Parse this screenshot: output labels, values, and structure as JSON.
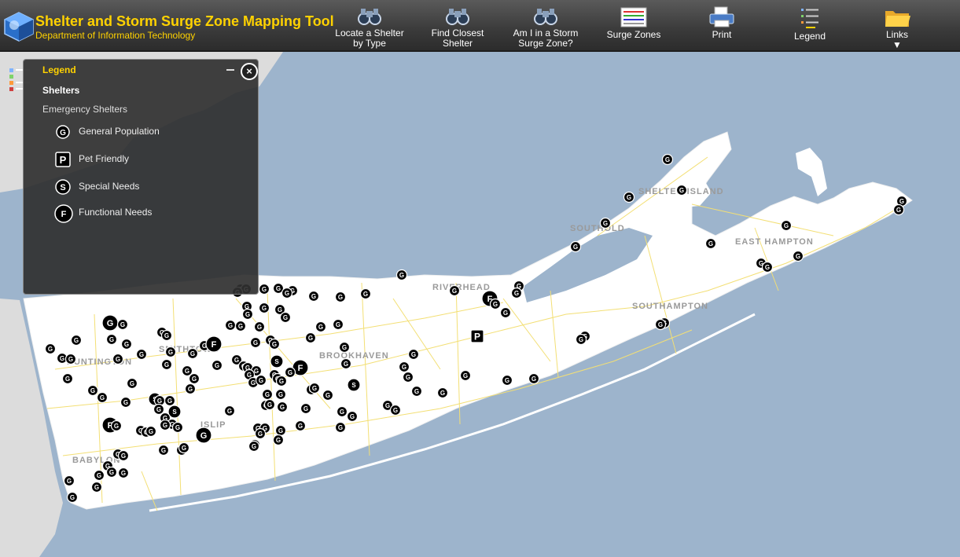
{
  "header": {
    "title": "Shelter and Storm Surge Zone Mapping Tool",
    "subtitle": "Department of Information Technology"
  },
  "toolbar": [
    {
      "label": "Locate a Shelter\nby Type",
      "icon": "binoculars-icon"
    },
    {
      "label": "Find Closest\nShelter",
      "icon": "binoculars-icon"
    },
    {
      "label": "Am I in a Storm\nSurge Zone?",
      "icon": "binoculars-icon"
    },
    {
      "label": "Surge Zones",
      "icon": "map-table-icon"
    },
    {
      "label": "Print",
      "icon": "printer-icon"
    },
    {
      "label": "Legend",
      "icon": "legend-list-icon"
    },
    {
      "label": "Links\n▼",
      "icon": "folder-icon"
    }
  ],
  "legend": {
    "title": "Legend",
    "layer": "Shelters",
    "group": "Emergency Shelters",
    "items": [
      {
        "letter": "G",
        "label": "General Population"
      },
      {
        "letter": "P",
        "label": "Pet Friendly"
      },
      {
        "letter": "S",
        "label": "Special Needs"
      },
      {
        "letter": "F",
        "label": "Functional Needs"
      }
    ]
  },
  "map": {
    "colors": {
      "water": "#9db4cc",
      "land": "#ffffff",
      "mainland": "#dcdcdc",
      "roads": "#f3df74",
      "marker": "#000000"
    },
    "places": [
      "SHELTER ISLAND",
      "SOUTHOLD",
      "EAST HAMPTON",
      "RIVERHEAD",
      "SOUTHAMPTON",
      "SMITHTOWN",
      "BROOKHAVEN",
      "HUNTINGTON",
      "ISLIP",
      "BABYLON"
    ]
  }
}
